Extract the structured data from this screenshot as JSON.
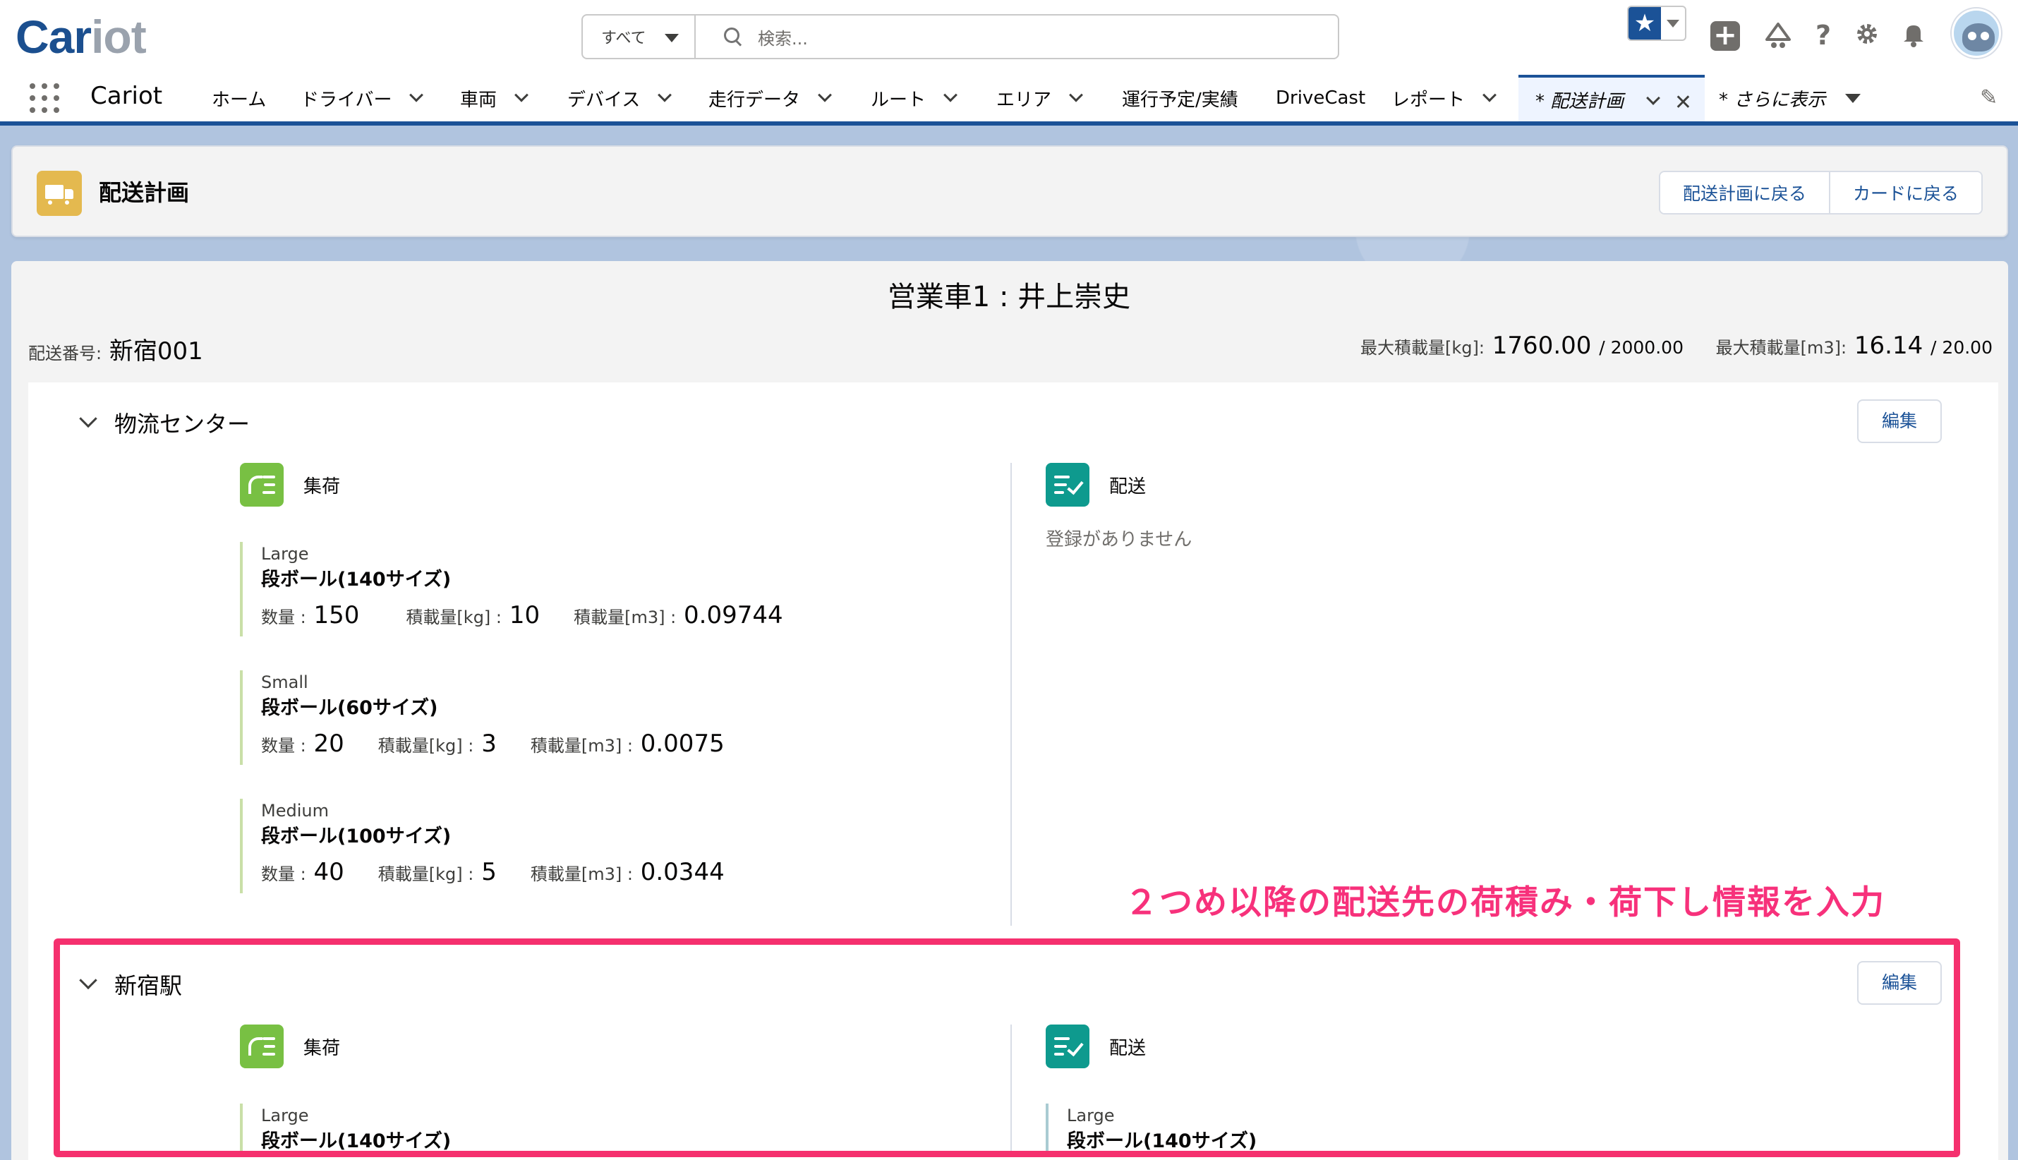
{
  "header": {
    "logo_part1": "Car",
    "logo_part2": "iot",
    "search_scope": "すべて",
    "search_placeholder": "検索...",
    "help_glyph": "?",
    "plus_glyph": "+"
  },
  "nav": {
    "app_name": "Cariot",
    "items": [
      {
        "label": "ホーム"
      },
      {
        "label": "ドライバー"
      },
      {
        "label": "車両"
      },
      {
        "label": "デバイス"
      },
      {
        "label": "走行データ"
      },
      {
        "label": "ルート"
      },
      {
        "label": "エリア"
      },
      {
        "label": "運行予定/実績"
      },
      {
        "label": "DriveCast"
      },
      {
        "label": "レポート"
      }
    ],
    "active_tab": "* 配送計画",
    "more": "* さらに表示"
  },
  "page_header": {
    "title": "配送計画",
    "buttons": [
      "配送計画に戻る",
      "カードに戻る"
    ]
  },
  "plan": {
    "vehicle_title": "営業車1 : 井上崇史",
    "delivery_no_label": "配送番号:",
    "delivery_no": "新宿001",
    "kg_label": "最大積載量[kg]:",
    "kg_value": "1760.00",
    "kg_max": "/ 2000.00",
    "m3_label": "最大積載量[m3]:",
    "m3_value": "16.14",
    "m3_max": "/ 20.00"
  },
  "labels": {
    "pickup": "集荷",
    "delivery": "配送",
    "edit": "編集",
    "empty": "登録がありません",
    "qty": "数量 :",
    "kg": "積載量[kg] :",
    "m3": "積載量[m3] :"
  },
  "sections": [
    {
      "name": "物流センター",
      "pickup_items": [
        {
          "size": "Large",
          "name": "段ボール(140サイズ)",
          "qty": "150",
          "kg": "10",
          "m3": "0.09744"
        },
        {
          "size": "Small",
          "name": "段ボール(60サイズ)",
          "qty": "20",
          "kg": "3",
          "m3": "0.0075"
        },
        {
          "size": "Medium",
          "name": "段ボール(100サイズ)",
          "qty": "40",
          "kg": "5",
          "m3": "0.0344"
        }
      ]
    },
    {
      "name": "新宿駅",
      "pickup_items": [
        {
          "size": "Large",
          "name": "段ボール(140サイズ)"
        }
      ],
      "delivery_items": [
        {
          "size": "Large",
          "name": "段ボール(140サイズ)"
        }
      ]
    }
  ],
  "annotation": "２つめ以降の配送先の荷積み・荷下し情報を入力",
  "colors": {
    "brand_blue": "#1b5297",
    "pickup_green": "#78c043",
    "delivery_teal": "#0e9a8e",
    "highlight_pink": "#f5306e",
    "page_header_icon": "#e4b94f"
  }
}
